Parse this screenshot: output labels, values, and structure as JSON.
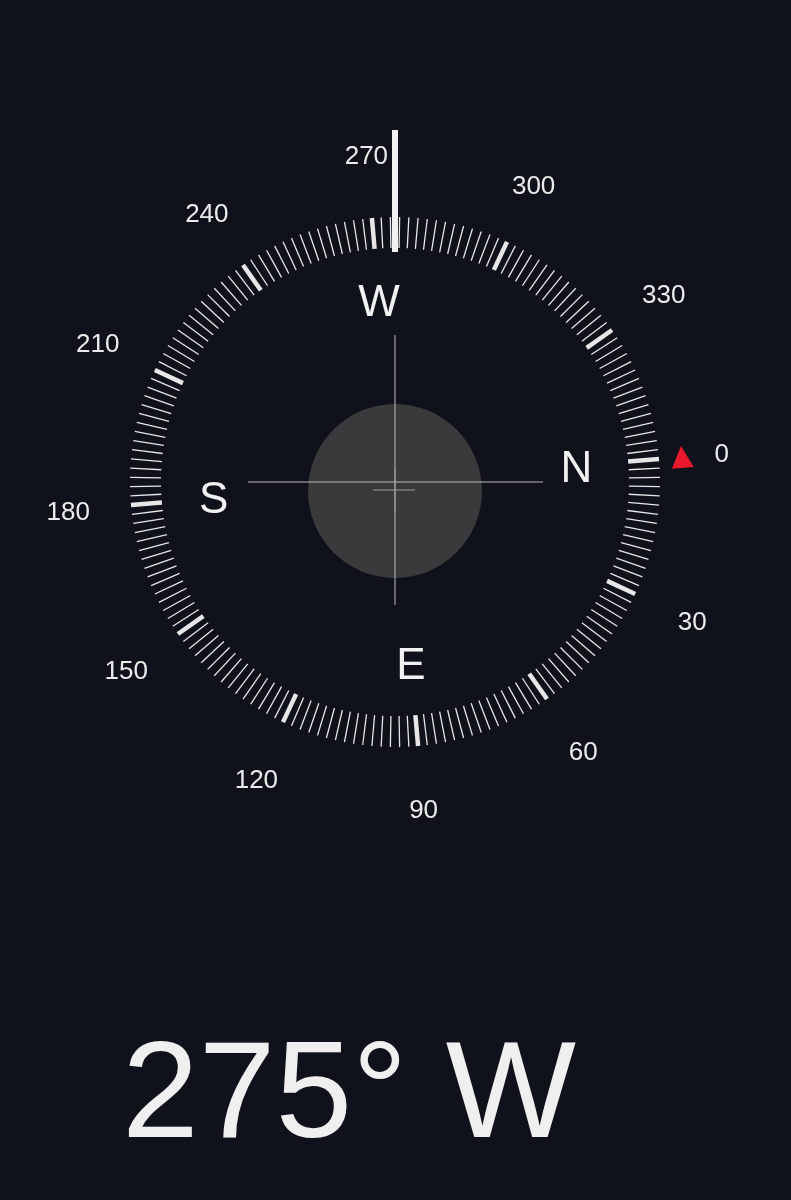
{
  "dial": {
    "degree_labels": [
      "0",
      "30",
      "60",
      "90",
      "120",
      "150",
      "180",
      "210",
      "240",
      "270",
      "300",
      "330"
    ],
    "cardinals": [
      "N",
      "E",
      "S",
      "W"
    ]
  },
  "heading": {
    "reading": "275° W"
  }
}
